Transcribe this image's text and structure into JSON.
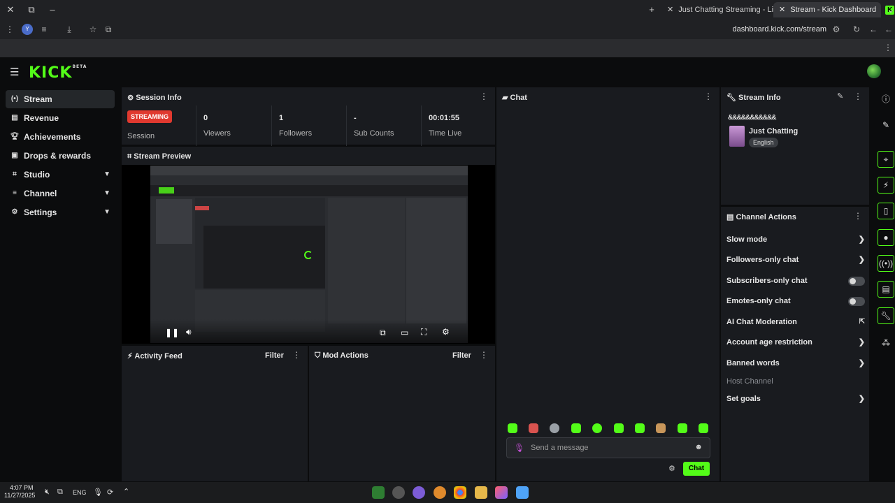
{
  "browser": {
    "tabs": [
      {
        "title": "Just Chatting Streaming - Live"
      },
      {
        "title": "Stream - Kick Dashboard"
      }
    ],
    "url": "dashboard.kick.com/stream"
  },
  "app": {
    "logo": "KICK",
    "logo_sup": "BETA"
  },
  "sidebar": {
    "items": [
      {
        "label": "Stream",
        "icon": "broadcast-icon",
        "active": true
      },
      {
        "label": "Revenue",
        "icon": "revenue-icon"
      },
      {
        "label": "Achievements",
        "icon": "trophy-icon"
      },
      {
        "label": "Drops & rewards",
        "icon": "gift-icon"
      },
      {
        "label": "Studio",
        "icon": "studio-icon",
        "expandable": true
      },
      {
        "label": "Channel",
        "icon": "channel-icon",
        "expandable": true
      },
      {
        "label": "Settings",
        "icon": "gear-icon",
        "expandable": true
      }
    ]
  },
  "session": {
    "title": "Session Info",
    "status": "STREAMING",
    "session_label": "Session",
    "stats": [
      {
        "value": "0",
        "label": "Viewers"
      },
      {
        "value": "1",
        "label": "Followers"
      },
      {
        "value": "-",
        "label": "Sub Counts"
      },
      {
        "value": "00:01:55",
        "label": "Time Live"
      }
    ]
  },
  "preview": {
    "title": "Stream Preview"
  },
  "activity": {
    "title": "Activity Feed",
    "filter": "Filter"
  },
  "mod": {
    "title": "Mod Actions",
    "filter": "Filter"
  },
  "chat": {
    "title": "Chat",
    "placeholder": "Send a message",
    "send_label": "Chat"
  },
  "stream_info": {
    "title": "Stream Info",
    "stream_title": "&&&&&&&&&&&",
    "category": "Just Chatting",
    "language": "English"
  },
  "channel_actions": {
    "title": "Channel Actions",
    "items": [
      {
        "label": "Slow mode",
        "control": "arrow"
      },
      {
        "label": "Followers-only chat",
        "control": "arrow"
      },
      {
        "label": "Subscribers-only chat",
        "control": "toggle",
        "on": false
      },
      {
        "label": "Emotes-only chat",
        "control": "toggle",
        "on": false
      },
      {
        "label": "AI Chat Moderation",
        "control": "external"
      },
      {
        "label": "Account age restriction",
        "control": "arrow"
      },
      {
        "label": "Banned words",
        "control": "arrow"
      },
      {
        "label": "Host Channel",
        "control": "none",
        "disabled": true
      },
      {
        "label": "Set goals",
        "control": "arrow"
      }
    ]
  },
  "taskbar": {
    "time": "4:07 PM",
    "date": "11/27/2025",
    "lang": "ENG"
  },
  "colors": {
    "accent": "#53fc18",
    "live": "#e0392f",
    "panel": "#191b1f"
  }
}
